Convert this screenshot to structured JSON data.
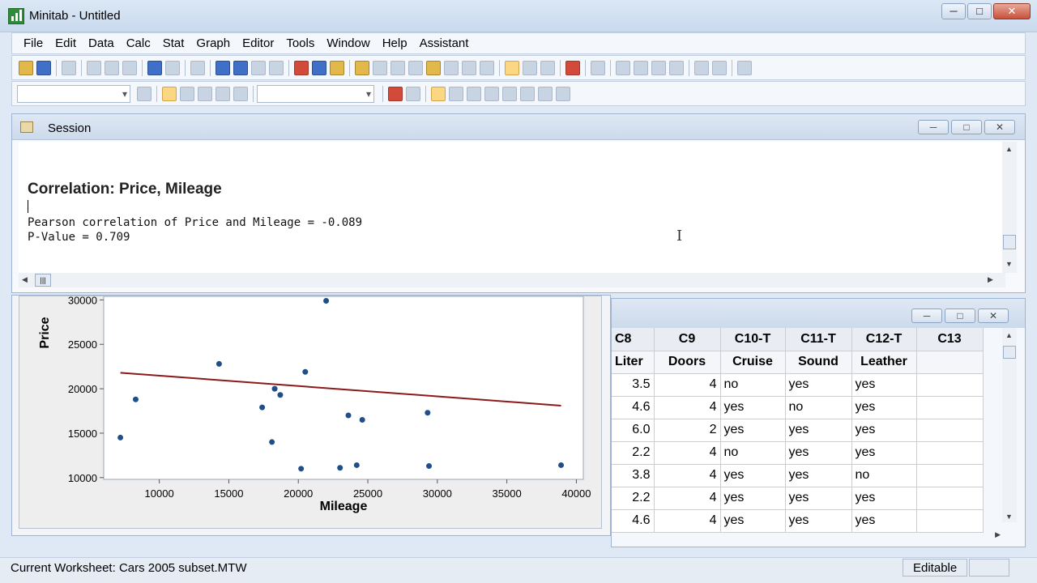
{
  "window": {
    "title": "Minitab - Untitled",
    "min": "─",
    "max": "□",
    "close": "✕"
  },
  "menu": [
    "File",
    "Edit",
    "Data",
    "Calc",
    "Stat",
    "Graph",
    "Editor",
    "Tools",
    "Window",
    "Help",
    "Assistant"
  ],
  "session": {
    "title": "Session",
    "heading": "Correlation: Price, Mileage",
    "line1": "Pearson correlation of Price and Mileage = -0.089",
    "line2": "P-Value = 0.709",
    "scroll_left": "◀",
    "scroll_right": "▶",
    "scroll_up": "▲",
    "scroll_down": "▼",
    "hthumb": "|||",
    "ibeam": "I"
  },
  "chart_data": {
    "type": "scatter",
    "xlabel": "Mileage",
    "ylabel": "Price",
    "xlim": [
      6000,
      40500
    ],
    "ylim": [
      9800,
      30400
    ],
    "xticks": [
      10000,
      15000,
      20000,
      25000,
      30000,
      35000,
      40000
    ],
    "yticks": [
      10000,
      15000,
      20000,
      25000,
      30000
    ],
    "points": [
      {
        "x": 7200,
        "y": 14500
      },
      {
        "x": 8300,
        "y": 18800
      },
      {
        "x": 14300,
        "y": 22800
      },
      {
        "x": 17400,
        "y": 17900
      },
      {
        "x": 18100,
        "y": 14000
      },
      {
        "x": 18300,
        "y": 20000
      },
      {
        "x": 18700,
        "y": 19300
      },
      {
        "x": 20200,
        "y": 11000
      },
      {
        "x": 20500,
        "y": 21900
      },
      {
        "x": 22000,
        "y": 29900
      },
      {
        "x": 23000,
        "y": 11100
      },
      {
        "x": 23600,
        "y": 17000
      },
      {
        "x": 24200,
        "y": 11400
      },
      {
        "x": 24600,
        "y": 16500
      },
      {
        "x": 29300,
        "y": 17300
      },
      {
        "x": 29400,
        "y": 11300
      },
      {
        "x": 38900,
        "y": 11400
      }
    ],
    "fit_line": {
      "x": [
        7200,
        38900
      ],
      "y": [
        21800,
        18100
      ]
    },
    "point_color": "#1f4e89",
    "line_color": "#8b1a1a"
  },
  "worksheet": {
    "columns": [
      "C8",
      "C9",
      "C10-T",
      "C11-T",
      "C12-T",
      "C13"
    ],
    "names": [
      "Liter",
      "Doors",
      "Cruise",
      "Sound",
      "Leather",
      ""
    ],
    "rows": [
      [
        "3.5",
        "4",
        "no",
        "yes",
        "yes",
        ""
      ],
      [
        "4.6",
        "4",
        "yes",
        "no",
        "yes",
        ""
      ],
      [
        "6.0",
        "2",
        "yes",
        "yes",
        "yes",
        ""
      ],
      [
        "2.2",
        "4",
        "no",
        "yes",
        "yes",
        ""
      ],
      [
        "3.8",
        "4",
        "yes",
        "yes",
        "no",
        ""
      ],
      [
        "2.2",
        "4",
        "yes",
        "yes",
        "yes",
        ""
      ],
      [
        "4.6",
        "4",
        "yes",
        "yes",
        "yes",
        ""
      ]
    ]
  },
  "statusbar": {
    "worksheet": "Current Worksheet: Cars 2005 subset.MTW",
    "mode": "Editable"
  }
}
